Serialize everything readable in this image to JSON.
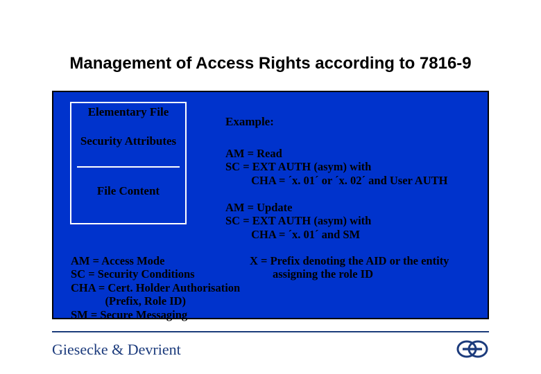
{
  "title": "Management of Access Rights according to  7816-9",
  "ef_box": {
    "header": "Elementary File",
    "security_attributes": "Security\nAttributes",
    "file_content": "File\nContent"
  },
  "example": {
    "header": "Example:",
    "block1": "AM = Read\nSC = EXT AUTH (asym) with\n         CHA = ´x. 01´ or ´x. 02´ and User AUTH",
    "block2": "AM = Update\nSC = EXT AUTH (asym) with\n         CHA = ´x. 01´ and SM"
  },
  "legend": {
    "left": "AM = Access Mode\nSC = Security Conditions\nCHA = Cert. Holder Authorisation\n            (Prefix, Role ID)\nSM = Secure Messaging",
    "right": "X = Prefix denoting the AID or the entity\n        assigning the role ID"
  },
  "footer": {
    "brand": "Giesecke & Devrient"
  },
  "colors": {
    "panel": "#0033cc",
    "brand": "#1c3b7c"
  }
}
